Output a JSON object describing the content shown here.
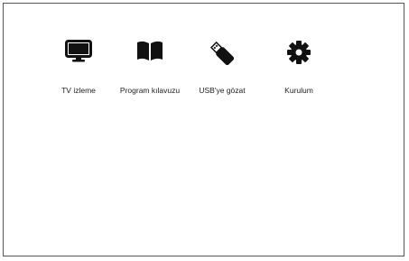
{
  "menu": {
    "items": [
      {
        "label": "TV izleme",
        "icon": "tv-monitor-icon"
      },
      {
        "label": "Program kılavuzu",
        "icon": "open-book-icon"
      },
      {
        "label": "USB'ye gözat",
        "icon": "usb-stick-icon"
      },
      {
        "label": "Kurulum",
        "icon": "gear-icon"
      }
    ]
  },
  "colors": {
    "icon": "#111111",
    "text": "#222222",
    "border": "#555555",
    "background": "#ffffff"
  }
}
